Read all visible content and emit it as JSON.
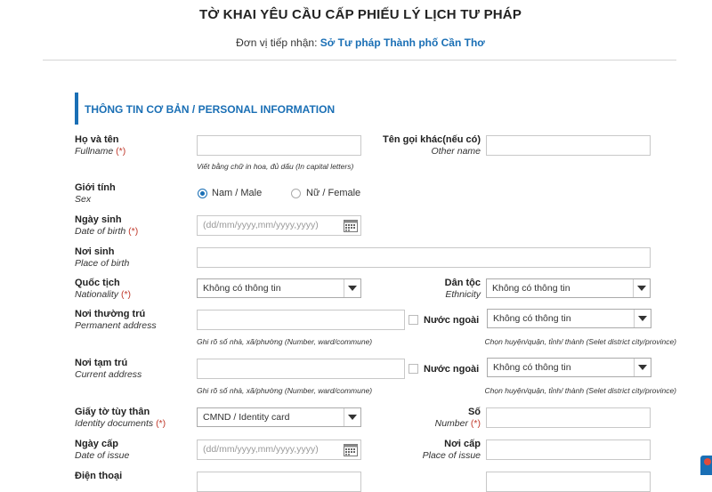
{
  "header": {
    "title": "TỜ KHAI YÊU CẦU CẤP PHIẾU LÝ LỊCH TƯ PHÁP",
    "org_label": "Đơn vị tiếp nhận:",
    "org_name": "Sở Tư pháp Thành phố Cần Thơ"
  },
  "section": {
    "title": "THÔNG TIN CƠ BẢN / PERSONAL INFORMATION"
  },
  "fields": {
    "fullname": {
      "label": "Họ và tên",
      "sub": "Fullname",
      "req": "(*)",
      "value": "",
      "hint": "Viết bằng chữ in hoa, đủ dấu (In capital letters)"
    },
    "other_name": {
      "label": "Tên gọi khác(nếu có)",
      "sub": "Other name",
      "value": ""
    },
    "sex": {
      "label": "Giới tính",
      "sub": "Sex",
      "option_male": "Nam / Male",
      "option_female": "Nữ / Female",
      "selected": "male"
    },
    "dob": {
      "label": "Ngày sinh",
      "sub": "Date of birth",
      "req": "(*)",
      "placeholder": "(dd/mm/yyyy,mm/yyyy,yyyy)"
    },
    "birthplace": {
      "label": "Nơi sinh",
      "sub": "Place of birth",
      "value": ""
    },
    "nationality": {
      "label": "Quốc tịch",
      "sub": "Nationality",
      "req": "(*)",
      "selected": "Không có thông tin"
    },
    "ethnicity": {
      "label": "Dân tộc",
      "sub": "Ethnicity",
      "selected": "Không có thông tin"
    },
    "permanent": {
      "label": "Nơi thường trú",
      "sub": "Permanent address",
      "value": "",
      "foreign_label": "Nước ngoài",
      "district_selected": "Không có thông tin",
      "hint_left": "Ghi rõ số nhà, xã/phường (Number, ward/commune)",
      "hint_right": "Chọn huyện/quận, tỉnh/ thành (Selet district city/province)"
    },
    "current": {
      "label": "Nơi tạm trú",
      "sub": "Current address",
      "value": "",
      "foreign_label": "Nước ngoài",
      "district_selected": "Không có thông tin",
      "hint_left": "Ghi rõ số nhà, xã/phường (Number, ward/commune)",
      "hint_right": "Chọn huyện/quận, tỉnh/ thành (Selet district city/province)"
    },
    "id_doc": {
      "label": "Giấy tờ tùy thân",
      "sub": "Identity documents",
      "req": "(*)",
      "selected": "CMND / Identity card"
    },
    "id_number": {
      "label": "Số",
      "sub": "Number",
      "req": "(*)",
      "value": ""
    },
    "issue_date": {
      "label": "Ngày cấp",
      "sub": "Date of issue",
      "placeholder": "(dd/mm/yyyy,mm/yyyy,yyyy)"
    },
    "issue_place": {
      "label": "Nơi cấp",
      "sub": "Place of issue",
      "value": ""
    },
    "phone": {
      "label": "Điện thoại"
    }
  },
  "colors": {
    "accent": "#1a6fb5",
    "required": "#c0392b"
  }
}
